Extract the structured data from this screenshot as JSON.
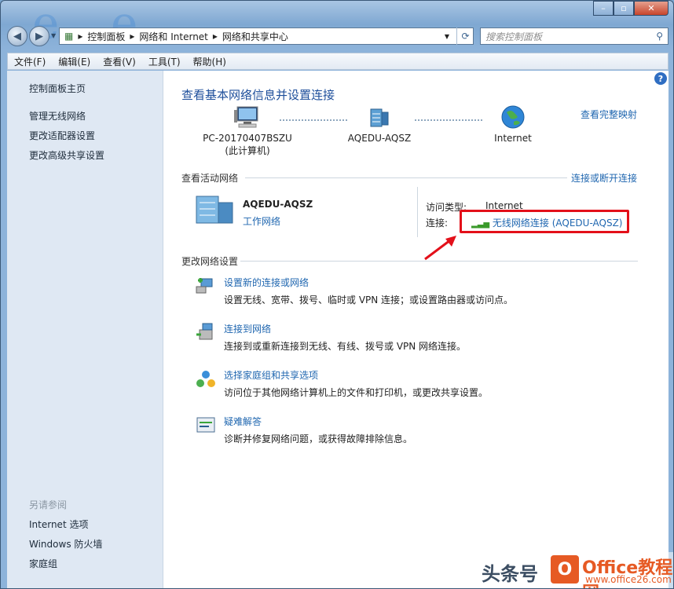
{
  "window": {
    "controls": {
      "minimize": "–",
      "maximize": "▫",
      "close": "✕"
    }
  },
  "nav": {
    "breadcrumb": [
      "控制面板",
      "网络和 Internet",
      "网络和共享中心"
    ],
    "search_placeholder": "搜索控制面板"
  },
  "menu": [
    "文件(F)",
    "编辑(E)",
    "查看(V)",
    "工具(T)",
    "帮助(H)"
  ],
  "sidebar": {
    "links": [
      "控制面板主页",
      "管理无线网络",
      "更改适配器设置",
      "更改高级共享设置"
    ],
    "see_also_title": "另请参阅",
    "see_also": [
      "Internet 选项",
      "Windows 防火墙",
      "家庭组"
    ]
  },
  "main": {
    "title": "查看基本网络信息并设置连接",
    "full_map": "查看完整映射",
    "nodes": [
      {
        "line1": "PC-20170407BSZU",
        "line2": "(此计算机)"
      },
      {
        "line1": "AQEDU-AQSZ",
        "line2": ""
      },
      {
        "line1": "Internet",
        "line2": ""
      }
    ],
    "active_networks": {
      "title": "查看活动网络",
      "action": "连接或断开连接",
      "name": "AQEDU-AQSZ",
      "category": "工作网络",
      "access_label": "访问类型:",
      "access_value": "Internet",
      "conn_label": "连接:",
      "conn_value": "无线网络连接 (AQEDU-AQSZ)"
    },
    "change_settings": {
      "title": "更改网络设置",
      "tasks": [
        {
          "title": "设置新的连接或网络",
          "desc": "设置无线、宽带、拨号、临时或 VPN 连接；或设置路由器或访问点。"
        },
        {
          "title": "连接到网络",
          "desc": "连接到或重新连接到无线、有线、拨号或 VPN 网络连接。"
        },
        {
          "title": "选择家庭组和共享选项",
          "desc": "访问位于其他网络计算机上的文件和打印机，或更改共享设置。"
        },
        {
          "title": "疑难解答",
          "desc": "诊断并修复网络问题，或获得故障排除信息。"
        }
      ]
    }
  },
  "watermark": {
    "source": "头条号",
    "brand": "Office教程网",
    "url": "www.office26.com"
  }
}
